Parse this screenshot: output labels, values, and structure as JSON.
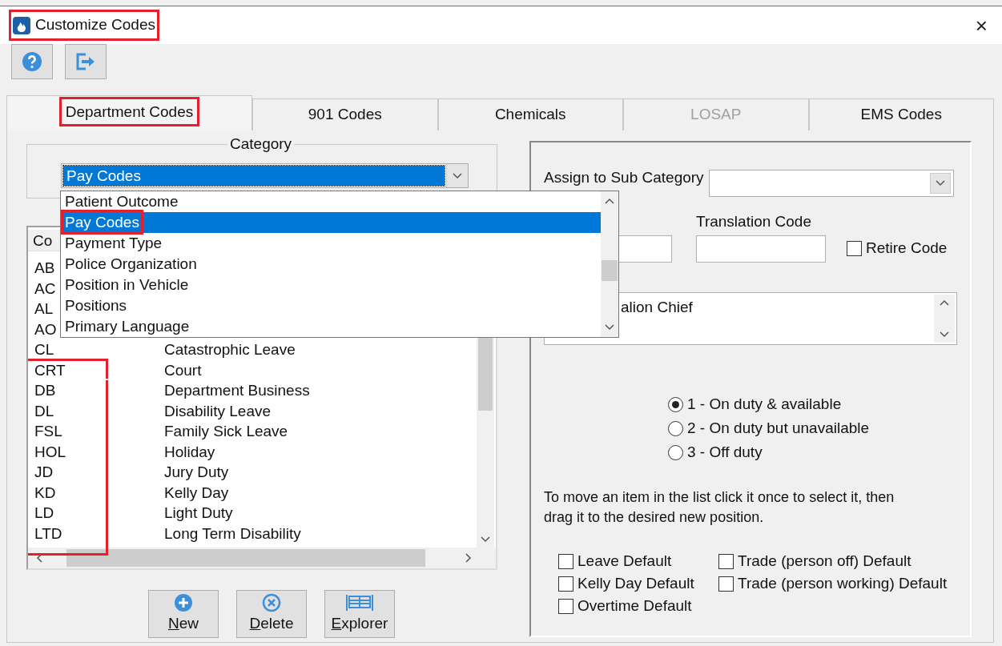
{
  "window": {
    "title": "Customize Codes",
    "title_highlighted": true,
    "close": "×"
  },
  "toolbar": [
    {
      "kind": "help"
    },
    {
      "kind": "exit"
    }
  ],
  "tabs": [
    {
      "label": "Department Codes",
      "selected": true,
      "disabled": false,
      "highlighted": true
    },
    {
      "label": "901 Codes",
      "selected": false,
      "disabled": false,
      "highlighted": false
    },
    {
      "label": "Chemicals",
      "selected": false,
      "disabled": false,
      "highlighted": false
    },
    {
      "label": "LOSAP",
      "selected": false,
      "disabled": true,
      "highlighted": false
    },
    {
      "label": "EMS Codes",
      "selected": false,
      "disabled": false,
      "highlighted": false
    }
  ],
  "category": {
    "legend": "Category",
    "value": "Pay Codes",
    "options": [
      {
        "label": "Patient Outcome",
        "selected": false,
        "highlighted": false
      },
      {
        "label": "Pay Codes",
        "selected": true,
        "highlighted": true
      },
      {
        "label": "Payment Type",
        "selected": false,
        "highlighted": false
      },
      {
        "label": "Police Organization",
        "selected": false,
        "highlighted": false
      },
      {
        "label": "Position in Vehicle",
        "selected": false,
        "highlighted": false
      },
      {
        "label": "Positions",
        "selected": false,
        "highlighted": false
      },
      {
        "label": "Primary Language",
        "selected": false,
        "highlighted": false
      }
    ]
  },
  "codes_list": {
    "header": "Co",
    "rows": [
      {
        "code": "AB",
        "highlighted": false
      },
      {
        "code": "AC",
        "highlighted": false
      },
      {
        "code": "AL",
        "highlighted": false
      },
      {
        "code": "AO",
        "highlighted": false
      },
      {
        "code": "CL",
        "description": "Catastrophic Leave",
        "highlighted": false
      },
      {
        "code": "CRT",
        "description": "Court",
        "highlighted": true
      },
      {
        "code": "DB",
        "description": "Department Business",
        "highlighted": true
      },
      {
        "code": "DL",
        "description": "Disability Leave",
        "highlighted": true
      },
      {
        "code": "FSL",
        "description": "Family Sick Leave",
        "highlighted": true
      },
      {
        "code": "HOL",
        "description": "Holiday",
        "highlighted": true
      },
      {
        "code": "JD",
        "description": "Jury Duty",
        "highlighted": true
      },
      {
        "code": "KD",
        "description": "Kelly Day",
        "highlighted": true
      },
      {
        "code": "LD",
        "description": "Light Duty",
        "highlighted": true
      },
      {
        "code": "LTD",
        "description": "Long Term Disability",
        "highlighted": true
      }
    ]
  },
  "buttons": [
    {
      "label": "New",
      "kind": "new",
      "underline_first": true
    },
    {
      "label": "Delete",
      "kind": "delete",
      "underline_first": true
    },
    {
      "label": "Explorer",
      "kind": "explorer",
      "underline_first": true
    }
  ],
  "details": {
    "sub_category_label": "Assign to Sub Category",
    "translation_label": "Translation Code",
    "retire": {
      "label": "Retire Code",
      "checked": false
    },
    "description_text": "alion Chief",
    "radios": [
      {
        "label": "1 - On duty & available",
        "selected": true
      },
      {
        "label": "2 - On duty but unavailable",
        "selected": false
      },
      {
        "label": "3 - Off duty",
        "selected": false
      }
    ],
    "instructions": "To move an item in the list click it once to select it, then drag it to the desired new position.",
    "defaults": [
      {
        "label": "Leave Default",
        "checked": false
      },
      {
        "label": "Trade (person off) Default",
        "checked": false
      },
      {
        "label": "Kelly Day Default",
        "checked": false
      },
      {
        "label": "Trade (person working) Default",
        "checked": false
      },
      {
        "label": "Overtime Default",
        "checked": false
      }
    ]
  }
}
